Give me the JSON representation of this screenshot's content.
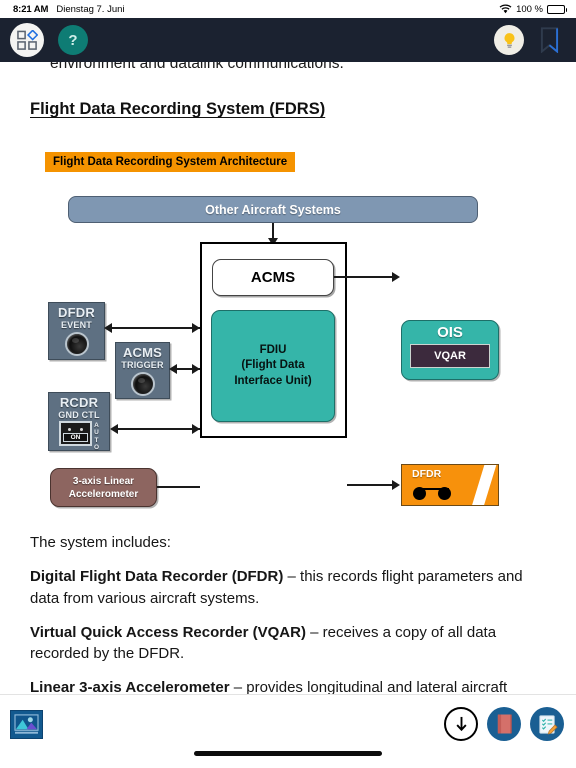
{
  "status_bar": {
    "time": "8:21 AM",
    "date": "Dienstag 7. Juni",
    "wifi_icon": "wifi-icon",
    "battery_percent": "100 %",
    "battery_icon": "battery-full-icon"
  },
  "toolbar": {
    "grid_icon": "grid-shapes-icon",
    "help_label": "?",
    "help_icon": "question-mark-icon",
    "bulb_icon": "lightbulb-icon",
    "bookmark_icon": "bookmark-icon"
  },
  "content": {
    "clipped_line": "environment and datalink communications.",
    "heading": "Flight Data Recording System (FDRS)",
    "paragraphs": [
      {
        "lead": "",
        "text": "The system includes:"
      },
      {
        "lead": "Digital Flight Data Recorder (DFDR)",
        "text": " – this records flight parameters and data from various aircraft systems."
      },
      {
        "lead": "Virtual Quick Access Recorder (VQAR)",
        "text": " – receives a copy of all data recorded by the DFDR."
      },
      {
        "lead": "Linear 3-axis Accelerometer",
        "text": " – provides longitudinal and lateral aircraft acceleration data to the recorder."
      }
    ]
  },
  "diagram": {
    "title": "Flight Data Recording System Architecture",
    "other_systems": "Other Aircraft Systems",
    "acms": "ACMS",
    "fdiu_line1": "FDIU",
    "fdiu_line2": "(Flight Data",
    "fdiu_line3": "Interface Unit)",
    "panel_dfdr_title": "DFDR",
    "panel_dfdr_sub": "EVENT",
    "panel_acms_title": "ACMS",
    "panel_acms_sub": "TRIGGER",
    "panel_rcdr_title": "RCDR",
    "panel_rcdr_sub": "GND CTL",
    "switch_on": "ON",
    "switch_auto": "AUTO",
    "accelerometer_line1": "3-axis Linear",
    "accelerometer_line2": "Accelerometer",
    "ois": "OIS",
    "vqar": "VQAR",
    "dfdr_box": "DFDR",
    "colors": {
      "title_bg": "#f59300",
      "other_systems_bg": "#7f97b2",
      "teal": "#35b5a9",
      "panel_gray": "#5e7082",
      "accelerometer_brown": "#8d6560",
      "dfdr_orange": "#f7910c",
      "vqar_dark": "#3c2a3d"
    }
  },
  "bottom_bar": {
    "image_icon": "image-gallery-icon",
    "download_icon": "download-arrow-icon",
    "book_icon": "book-icon",
    "notes_icon": "notes-pencil-icon",
    "home_indicator": "home-indicator"
  }
}
